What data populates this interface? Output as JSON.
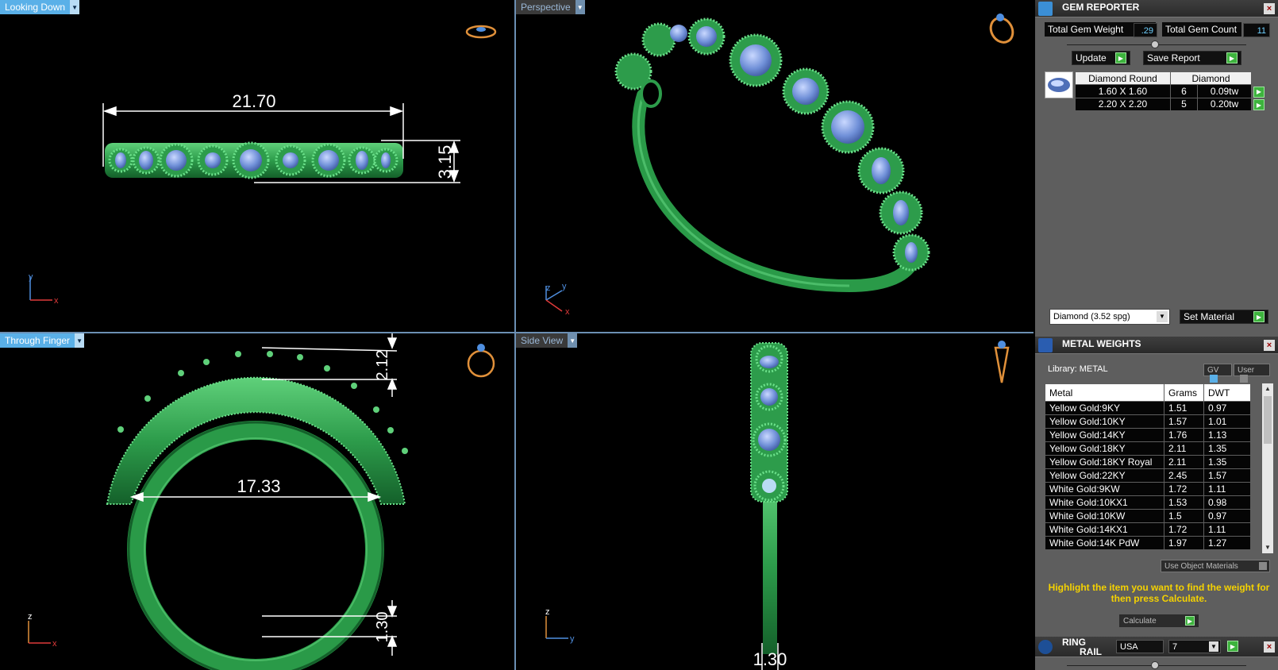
{
  "viewports": {
    "top": {
      "label": "Looking Down",
      "dims": {
        "width": "21.70",
        "height": "3.15"
      },
      "axis": [
        "y",
        "x"
      ]
    },
    "perspective": {
      "label": "Perspective",
      "axis": [
        "z",
        "y",
        "x"
      ]
    },
    "front": {
      "label": "Through Finger",
      "dims": {
        "inner": "17.33",
        "top": "2.12",
        "bottom": "1.30"
      },
      "axis": [
        "z",
        "x"
      ]
    },
    "side": {
      "label": "Side View",
      "dims": {
        "bottom": "1.30"
      },
      "axis": [
        "z",
        "y"
      ]
    }
  },
  "gem_reporter": {
    "title": "GEM REPORTER",
    "total_weight_label": "Total Gem Weight",
    "total_weight_value": ".29",
    "total_count_label": "Total Gem Count",
    "total_count_value": "11",
    "update_label": "Update",
    "save_label": "Save Report",
    "table_header": [
      "Diamond Round",
      "Diamond"
    ],
    "rows": [
      {
        "size": "1.60 X 1.60",
        "count": "6",
        "weight": "0.09tw"
      },
      {
        "size": "2.20 X 2.20",
        "count": "5",
        "weight": "0.20tw"
      }
    ],
    "material_select": "Diamond    (3.52 spg)",
    "set_material_label": "Set Material"
  },
  "metal_weights": {
    "title": "METAL WEIGHTS",
    "library_label": "Library: METAL",
    "gv_label": "GV",
    "user_label": "User",
    "columns": [
      "Metal",
      "Grams",
      "DWT"
    ],
    "rows": [
      [
        "Yellow Gold:9KY",
        "1.51",
        "0.97"
      ],
      [
        "Yellow Gold:10KY",
        "1.57",
        "1.01"
      ],
      [
        "Yellow Gold:14KY",
        "1.76",
        "1.13"
      ],
      [
        "Yellow Gold:18KY",
        "2.11",
        "1.35"
      ],
      [
        "Yellow Gold:18KY Royal",
        "2.11",
        "1.35"
      ],
      [
        "Yellow Gold:22KY",
        "2.45",
        "1.57"
      ],
      [
        "White Gold:9KW",
        "1.72",
        "1.11"
      ],
      [
        "White Gold:10KX1",
        "1.53",
        "0.98"
      ],
      [
        "White Gold:10KW",
        "1.5",
        "0.97"
      ],
      [
        "White Gold:14KX1",
        "1.72",
        "1.11"
      ],
      [
        "White Gold:14K PdW",
        "1.97",
        "1.27"
      ]
    ],
    "use_object_materials": "Use Object Materials",
    "hint": "Highlight the item you want to find the weight for then press Calculate.",
    "calculate_label": "Calculate"
  },
  "ring_rail": {
    "title_line1": "RING",
    "title_line2": "RAIL",
    "region": "USA",
    "size": "7"
  },
  "colors": {
    "metal": "#2fa350",
    "gem": "#6f8ed6",
    "panel": "#5e5e5e",
    "accent": "#5ab0e8"
  }
}
